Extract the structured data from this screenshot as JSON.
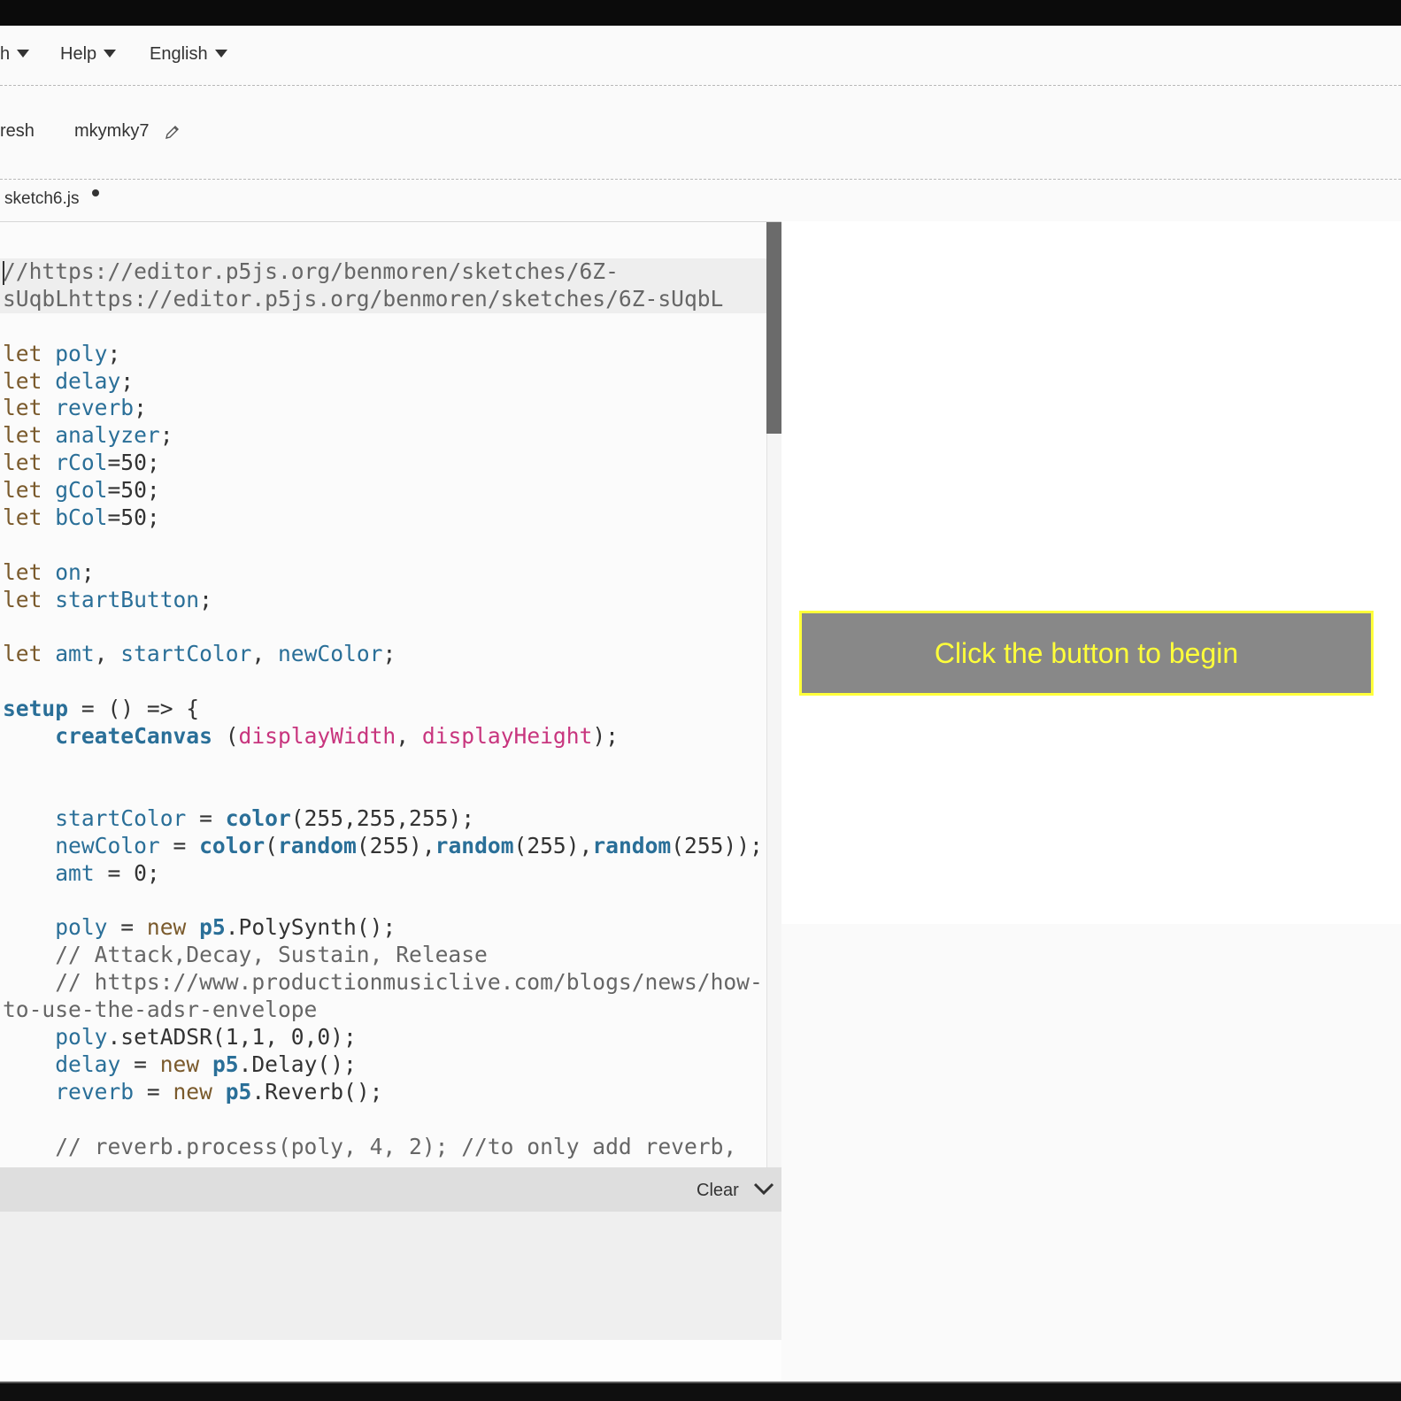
{
  "nav": {
    "items": [
      {
        "label": "h"
      },
      {
        "label": "Help"
      },
      {
        "label": "English"
      }
    ]
  },
  "toolbar": {
    "refresh_label": "resh",
    "sketch_name": "mkymky7"
  },
  "editor": {
    "file_tab": "sketch6.js",
    "code_lines": [
      [
        [
          "cm",
          "//https://editor.p5js.org/benmoren/sketches/6Z-"
        ]
      ],
      [
        [
          "cm",
          "sUqbLhttps://editor.p5js.org/benmoren/sketches/6Z-sUqbL"
        ]
      ],
      [],
      [
        [
          "kw",
          "let "
        ],
        [
          "vr",
          "poly"
        ],
        [
          "nm",
          ";"
        ]
      ],
      [
        [
          "kw",
          "let "
        ],
        [
          "vr",
          "delay"
        ],
        [
          "nm",
          ";"
        ]
      ],
      [
        [
          "kw",
          "let "
        ],
        [
          "vr",
          "reverb"
        ],
        [
          "nm",
          ";"
        ]
      ],
      [
        [
          "kw",
          "let "
        ],
        [
          "vr",
          "analyzer"
        ],
        [
          "nm",
          ";"
        ]
      ],
      [
        [
          "kw",
          "let "
        ],
        [
          "vr",
          "rCol"
        ],
        [
          "nm",
          "=50;"
        ]
      ],
      [
        [
          "kw",
          "let "
        ],
        [
          "vr",
          "gCol"
        ],
        [
          "nm",
          "=50;"
        ]
      ],
      [
        [
          "kw",
          "let "
        ],
        [
          "vr",
          "bCol"
        ],
        [
          "nm",
          "=50;"
        ]
      ],
      [],
      [
        [
          "kw",
          "let "
        ],
        [
          "vr",
          "on"
        ],
        [
          "nm",
          ";"
        ]
      ],
      [
        [
          "kw",
          "let "
        ],
        [
          "vr",
          "startButton"
        ],
        [
          "nm",
          ";"
        ]
      ],
      [],
      [
        [
          "kw",
          "let "
        ],
        [
          "vr",
          "amt"
        ],
        [
          "nm",
          ", "
        ],
        [
          "vr",
          "startColor"
        ],
        [
          "nm",
          ", "
        ],
        [
          "vr",
          "newColor"
        ],
        [
          "nm",
          ";"
        ]
      ],
      [],
      [
        [
          "fn",
          "setup"
        ],
        [
          "nm",
          " = () => {"
        ]
      ],
      [
        [
          "nm",
          "    "
        ],
        [
          "fn",
          "createCanvas"
        ],
        [
          "nm",
          " ("
        ],
        [
          "pr",
          "displayWidth"
        ],
        [
          "nm",
          ", "
        ],
        [
          "pr",
          "displayHeight"
        ],
        [
          "nm",
          ");"
        ]
      ],
      [],
      [],
      [
        [
          "nm",
          "    "
        ],
        [
          "vr",
          "startColor"
        ],
        [
          "nm",
          " = "
        ],
        [
          "fn",
          "color"
        ],
        [
          "nm",
          "(255,255,255);"
        ]
      ],
      [
        [
          "nm",
          "    "
        ],
        [
          "vr",
          "newColor"
        ],
        [
          "nm",
          " = "
        ],
        [
          "fn",
          "color"
        ],
        [
          "nm",
          "("
        ],
        [
          "fn",
          "random"
        ],
        [
          "nm",
          "(255),"
        ],
        [
          "fn",
          "random"
        ],
        [
          "nm",
          "(255),"
        ],
        [
          "fn",
          "random"
        ],
        [
          "nm",
          "(255));"
        ]
      ],
      [
        [
          "nm",
          "    "
        ],
        [
          "vr",
          "amt"
        ],
        [
          "nm",
          " = 0;"
        ]
      ],
      [],
      [
        [
          "nm",
          "    "
        ],
        [
          "vr",
          "poly"
        ],
        [
          "nm",
          " = "
        ],
        [
          "kw",
          "new "
        ],
        [
          "fn",
          "p5"
        ],
        [
          "nm",
          ".PolySynth();"
        ]
      ],
      [
        [
          "nm",
          "    "
        ],
        [
          "cm",
          "// Attack,Decay, Sustain, Release"
        ]
      ],
      [
        [
          "nm",
          "    "
        ],
        [
          "cm",
          "// https://www.productionmusiclive.com/blogs/news/how-"
        ]
      ],
      [
        [
          "cm",
          "to-use-the-adsr-envelope"
        ]
      ],
      [
        [
          "nm",
          "    "
        ],
        [
          "vr",
          "poly"
        ],
        [
          "nm",
          ".setADSR(1,1, 0,0);"
        ]
      ],
      [
        [
          "nm",
          "    "
        ],
        [
          "vr",
          "delay"
        ],
        [
          "nm",
          " = "
        ],
        [
          "kw",
          "new "
        ],
        [
          "fn",
          "p5"
        ],
        [
          "nm",
          ".Delay();"
        ]
      ],
      [
        [
          "nm",
          "    "
        ],
        [
          "vr",
          "reverb"
        ],
        [
          "nm",
          " = "
        ],
        [
          "kw",
          "new "
        ],
        [
          "fn",
          "p5"
        ],
        [
          "nm",
          ".Reverb();"
        ]
      ],
      [],
      [
        [
          "nm",
          "    "
        ],
        [
          "cm",
          "// reverb.process(poly, 4, 2); //to only add reverb,"
        ]
      ]
    ]
  },
  "console": {
    "clear_label": "Clear"
  },
  "preview": {
    "begin_button": "Click the button to begin"
  },
  "colors": {
    "button_bg": "#888888",
    "button_text": "#ffff3a",
    "keyword": "#7a5a2c",
    "variable": "#2a6f98",
    "property": "#c8357e",
    "comment": "#666666"
  }
}
